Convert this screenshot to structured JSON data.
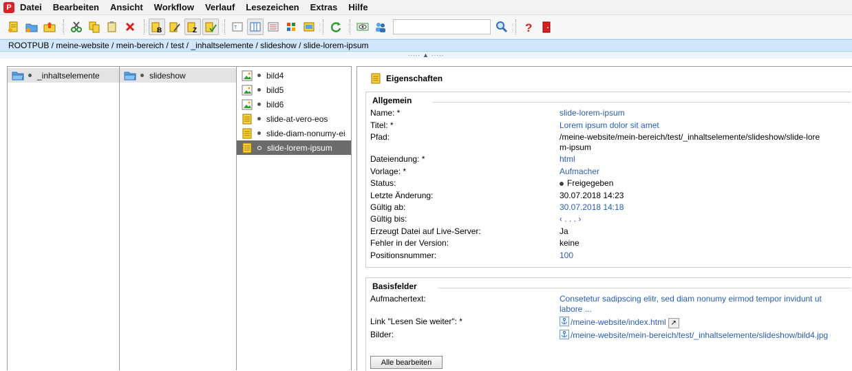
{
  "menu": [
    "Datei",
    "Bearbeiten",
    "Ansicht",
    "Workflow",
    "Verlauf",
    "Lesezeichen",
    "Extras",
    "Hilfe"
  ],
  "search": {
    "value": ""
  },
  "breadcrumb": "ROOTPUB / meine-website / mein-bereich / test / _inhaltselemente / slideshow / slide-lorem-ipsum",
  "columns": {
    "col1": [
      {
        "label": "_inhaltselemente"
      }
    ],
    "col2": [
      {
        "label": "slideshow"
      }
    ],
    "col3": [
      {
        "label": "bild4"
      },
      {
        "label": "bild5"
      },
      {
        "label": "bild6"
      },
      {
        "label": "slide-at-vero-eos"
      },
      {
        "label": "slide-diam-nonumy-ei"
      },
      {
        "label": "slide-lorem-ipsum"
      }
    ]
  },
  "details": {
    "title": "Eigenschaften",
    "allgemein": {
      "title": "Allgemein",
      "rows": [
        {
          "label": "Name: *",
          "value": "slide-lorem-ipsum"
        },
        {
          "label": "Titel: *",
          "value": "Lorem ipsum dolor sit amet"
        },
        {
          "label": "Pfad:",
          "value": "/meine-website/mein-bereich/test/_inhaltselemente/slideshow/slide-lorem-ipsum"
        },
        {
          "label": "Dateiendung: *",
          "value": "html"
        },
        {
          "label": "Vorlage: *",
          "value": "Aufmacher"
        },
        {
          "label": "Status:",
          "value": "Freigegeben"
        },
        {
          "label": "Letzte Änderung:",
          "value": "30.07.2018 14:23"
        },
        {
          "label": "Gültig ab:",
          "value": "30.07.2018 14:18"
        },
        {
          "label": "Gültig bis:",
          "value": "‹ . . . ›"
        },
        {
          "label": "Erzeugt Datei auf Live-Server:",
          "value": "Ja"
        },
        {
          "label": "Fehler in der Version:",
          "value": "keine"
        },
        {
          "label": "Positionsnummer:",
          "value": "100"
        }
      ]
    },
    "basisfelder": {
      "title": "Basisfelder",
      "rows": [
        {
          "label": "Aufmachertext:",
          "value": "Consetetur sadipscing elitr, sed diam nonumy eirmod tempor invidunt ut labore ..."
        },
        {
          "label": "Link \"Lesen Sie weiter\": *",
          "value": "/meine-website/index.html"
        },
        {
          "label": "Bilder:",
          "value": "/meine-website/mein-bereich/test/_inhaltselemente/slideshow/bild4.jpg"
        }
      ],
      "edit_button": "Alle bearbeiten"
    }
  },
  "colors": {
    "breadcrumb_bg": "#cfe6fb",
    "link": "#2a5db0",
    "selection": "#6b6b6b"
  }
}
